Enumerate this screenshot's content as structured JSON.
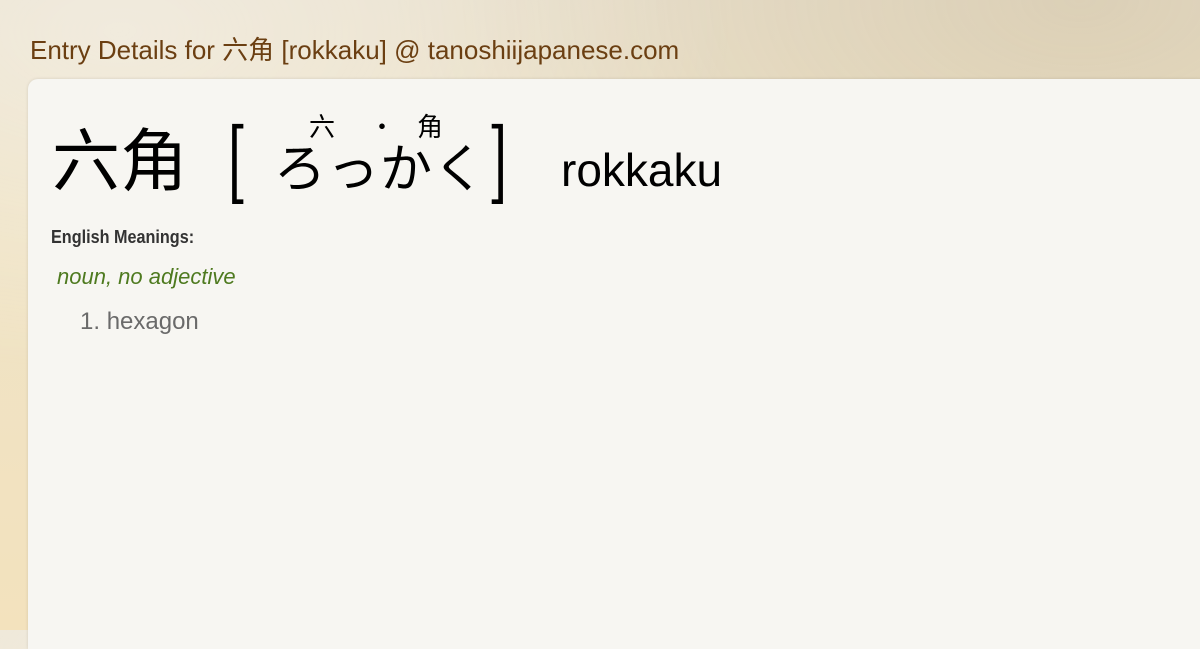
{
  "page": {
    "title": "Entry Details for 六角 [rokkaku] @ tanoshiijapanese.com"
  },
  "entry": {
    "kanji": "六角",
    "bracket_open": "[",
    "reading": "ろっかく",
    "bracket_close": "]",
    "furigana": [
      "六",
      "・",
      "角"
    ],
    "romaji": "rokkaku",
    "meanings_label": "English Meanings:",
    "part_of_speech": "noun, no adjective",
    "definitions": [
      {
        "number": "1.",
        "text": "hexagon"
      }
    ]
  },
  "colors": {
    "title": "#6b3f12",
    "part_of_speech": "#4e7a1f",
    "definition": "#6a6a6a",
    "card_background": "#f7f6f2"
  }
}
